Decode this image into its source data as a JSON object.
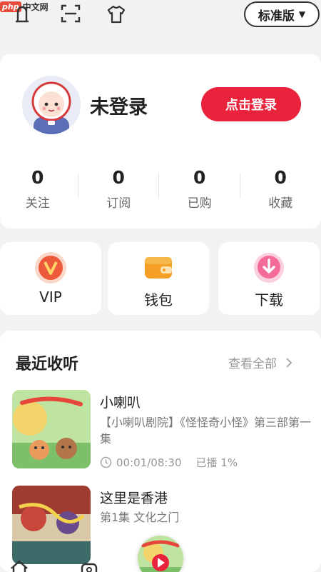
{
  "watermark": {
    "logo": "php",
    "text": "中文网"
  },
  "top_bar": {
    "edition_label": "标准版",
    "edition_arrow": "▼"
  },
  "profile": {
    "username": "未登录",
    "login_label": "点击登录",
    "stats": [
      {
        "value": "0",
        "label": "关注"
      },
      {
        "value": "0",
        "label": "订阅"
      },
      {
        "value": "0",
        "label": "已购"
      },
      {
        "value": "0",
        "label": "收藏"
      }
    ]
  },
  "quick_actions": [
    {
      "label": "VIP",
      "icon": "vip-icon"
    },
    {
      "label": "钱包",
      "icon": "wallet-icon"
    },
    {
      "label": "下载",
      "icon": "download-icon"
    }
  ],
  "recent": {
    "title": "最近收听",
    "view_all": "查看全部",
    "items": [
      {
        "title": "小喇叭",
        "desc": "【小喇叭剧院】《怪怪奇小怪》第三部第一集",
        "time": "00:01/08:30",
        "played": "已播 1%"
      },
      {
        "title": "这里是香港",
        "desc": "第1集 文化之门"
      }
    ]
  },
  "colors": {
    "accent": "#e8233b",
    "background": "#f2f2f2"
  }
}
